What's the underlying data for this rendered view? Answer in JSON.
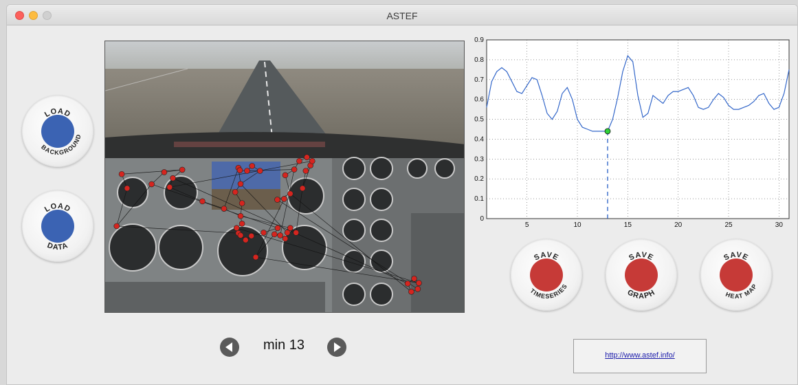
{
  "window": {
    "title": "ASTEF"
  },
  "left_buttons": {
    "load_background": {
      "top": "LOAD",
      "bottom": "BACKGROUND"
    },
    "load_data": {
      "top": "LOAD",
      "bottom": "DATA"
    }
  },
  "save_buttons": {
    "timeseries": {
      "top": "SAVE",
      "bottom": "TIMESERIES"
    },
    "graph": {
      "top": "SAVE",
      "bottom": "GRAPH"
    },
    "heatmap": {
      "top": "SAVE",
      "bottom": "HEAT MAP"
    }
  },
  "colors": {
    "load_button": "#3b63b3",
    "save_button": "#c63a37",
    "line": "#3266c9",
    "marker": "#2fd23a",
    "gaze_point": "#d5251f"
  },
  "nav": {
    "label": "min 13",
    "prev_icon": "left-arrow-icon",
    "next_icon": "right-arrow-icon"
  },
  "link": {
    "text": "http://www.astef.info/"
  },
  "chart_data": {
    "type": "line",
    "xlim": [
      1,
      31
    ],
    "ylim": [
      0,
      0.9
    ],
    "x_ticks": [
      5,
      10,
      15,
      20,
      25,
      30
    ],
    "y_ticks": [
      0,
      0.1,
      0.2,
      0.3,
      0.4,
      0.5,
      0.6,
      0.7,
      0.8,
      0.9
    ],
    "grid": true,
    "x": [
      1,
      1.5,
      2,
      2.5,
      3,
      3.5,
      4,
      4.5,
      5,
      5.5,
      6,
      6.5,
      7,
      7.5,
      8,
      8.5,
      9,
      9.5,
      10,
      10.5,
      11,
      11.5,
      12,
      12.5,
      13,
      13.5,
      14,
      14.5,
      15,
      15.5,
      16,
      16.5,
      17,
      17.5,
      18,
      18.5,
      19,
      19.5,
      20,
      20.5,
      21,
      21.5,
      22,
      22.5,
      23,
      23.5,
      24,
      24.5,
      25,
      25.5,
      26,
      26.5,
      27,
      27.5,
      28,
      28.5,
      29,
      29.5,
      30,
      30.5,
      31
    ],
    "y": [
      0.56,
      0.69,
      0.74,
      0.76,
      0.74,
      0.69,
      0.64,
      0.63,
      0.67,
      0.71,
      0.7,
      0.62,
      0.53,
      0.5,
      0.54,
      0.63,
      0.66,
      0.6,
      0.5,
      0.46,
      0.45,
      0.44,
      0.44,
      0.44,
      0.44,
      0.5,
      0.61,
      0.74,
      0.82,
      0.79,
      0.62,
      0.51,
      0.53,
      0.62,
      0.6,
      0.58,
      0.62,
      0.64,
      0.64,
      0.65,
      0.66,
      0.62,
      0.56,
      0.55,
      0.56,
      0.6,
      0.63,
      0.61,
      0.57,
      0.55,
      0.55,
      0.56,
      0.57,
      0.59,
      0.62,
      0.63,
      0.58,
      0.55,
      0.56,
      0.63,
      0.75
    ],
    "marker": {
      "x": 13,
      "y": 0.44
    }
  },
  "gaze_points": [
    [
      0.046,
      0.488
    ],
    [
      0.061,
      0.54
    ],
    [
      0.032,
      0.679
    ],
    [
      0.129,
      0.525
    ],
    [
      0.164,
      0.481
    ],
    [
      0.214,
      0.472
    ],
    [
      0.188,
      0.503
    ],
    [
      0.179,
      0.536
    ],
    [
      0.27,
      0.588
    ],
    [
      0.33,
      0.615
    ],
    [
      0.37,
      0.465
    ],
    [
      0.374,
      0.474
    ],
    [
      0.394,
      0.476
    ],
    [
      0.408,
      0.458
    ],
    [
      0.43,
      0.476
    ],
    [
      0.376,
      0.524
    ],
    [
      0.361,
      0.554
    ],
    [
      0.38,
      0.595
    ],
    [
      0.376,
      0.642
    ],
    [
      0.38,
      0.67
    ],
    [
      0.365,
      0.686
    ],
    [
      0.37,
      0.705
    ],
    [
      0.376,
      0.713
    ],
    [
      0.39,
      0.73
    ],
    [
      0.406,
      0.715
    ],
    [
      0.44,
      0.703
    ],
    [
      0.479,
      0.686
    ],
    [
      0.47,
      0.709
    ],
    [
      0.486,
      0.713
    ],
    [
      0.5,
      0.725
    ],
    [
      0.506,
      0.703
    ],
    [
      0.514,
      0.686
    ],
    [
      0.53,
      0.703
    ],
    [
      0.548,
      0.54
    ],
    [
      0.557,
      0.476
    ],
    [
      0.57,
      0.456
    ],
    [
      0.575,
      0.44
    ],
    [
      0.56,
      0.426
    ],
    [
      0.539,
      0.44
    ],
    [
      0.525,
      0.471
    ],
    [
      0.5,
      0.492
    ],
    [
      0.514,
      0.56
    ],
    [
      0.478,
      0.582
    ],
    [
      0.497,
      0.579
    ],
    [
      0.418,
      0.793
    ],
    [
      0.871,
      0.888
    ],
    [
      0.858,
      0.872
    ],
    [
      0.84,
      0.89
    ],
    [
      0.85,
      0.92
    ],
    [
      0.868,
      0.91
    ]
  ]
}
